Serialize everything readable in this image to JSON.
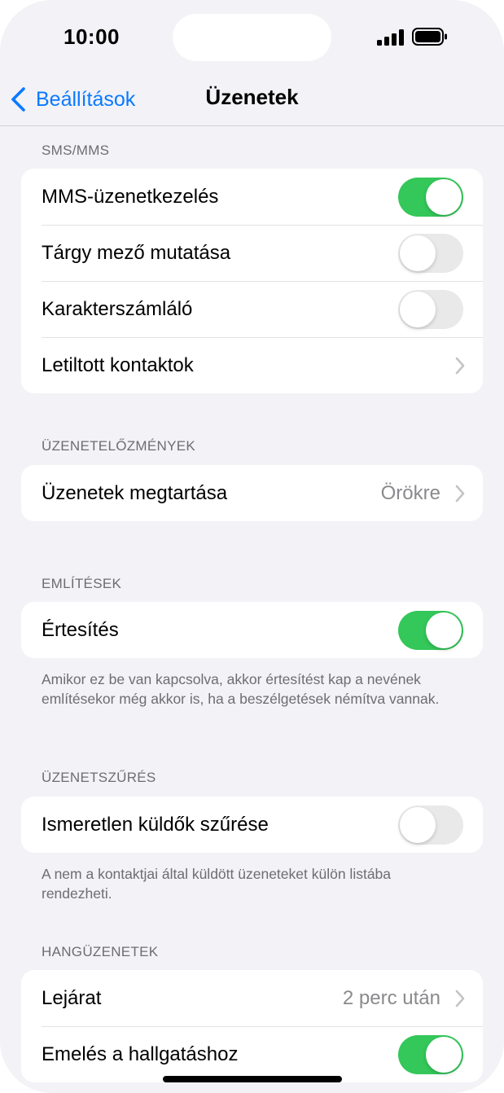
{
  "status": {
    "time": "10:00"
  },
  "nav": {
    "back_label": "Beállítások",
    "title": "Üzenetek"
  },
  "sections": {
    "sms": {
      "header": "SMS/MMS",
      "rows": [
        {
          "label": "MMS-üzenetkezelés",
          "type": "toggle",
          "on": true
        },
        {
          "label": "Tárgy mező mutatása",
          "type": "toggle",
          "on": false
        },
        {
          "label": "Karakterszámláló",
          "type": "toggle",
          "on": false
        },
        {
          "label": "Letiltott kontaktok",
          "type": "chevron"
        }
      ]
    },
    "history": {
      "header": "ÜZENETELŐZMÉNYEK",
      "rows": [
        {
          "label": "Üzenetek megtartása",
          "type": "value",
          "value": "Örökre"
        }
      ]
    },
    "mentions": {
      "header": "EMLÍTÉSEK",
      "rows": [
        {
          "label": "Értesítés",
          "type": "toggle",
          "on": true
        }
      ],
      "footer": "Amikor ez be van kapcsolva, akkor értesítést kap a nevének említésekor még akkor is, ha a beszélgetések némítva vannak."
    },
    "filter": {
      "header": "ÜZENETSZŰRÉS",
      "rows": [
        {
          "label": "Ismeretlen küldők szűrése",
          "type": "toggle",
          "on": false
        }
      ],
      "footer": "A nem a kontaktjai által küldött üzeneteket külön listába rendezheti."
    },
    "audio": {
      "header": "HANGÜZENETEK",
      "rows": [
        {
          "label": "Lejárat",
          "type": "value",
          "value": "2 perc után"
        },
        {
          "label": "Emelés a hallgatáshoz",
          "type": "toggle",
          "on": true
        }
      ]
    }
  },
  "colors": {
    "accent": "#0a7aff",
    "toggle_on": "#34c759",
    "toggle_off": "#e9e9ea",
    "background": "#f2f2f7"
  }
}
